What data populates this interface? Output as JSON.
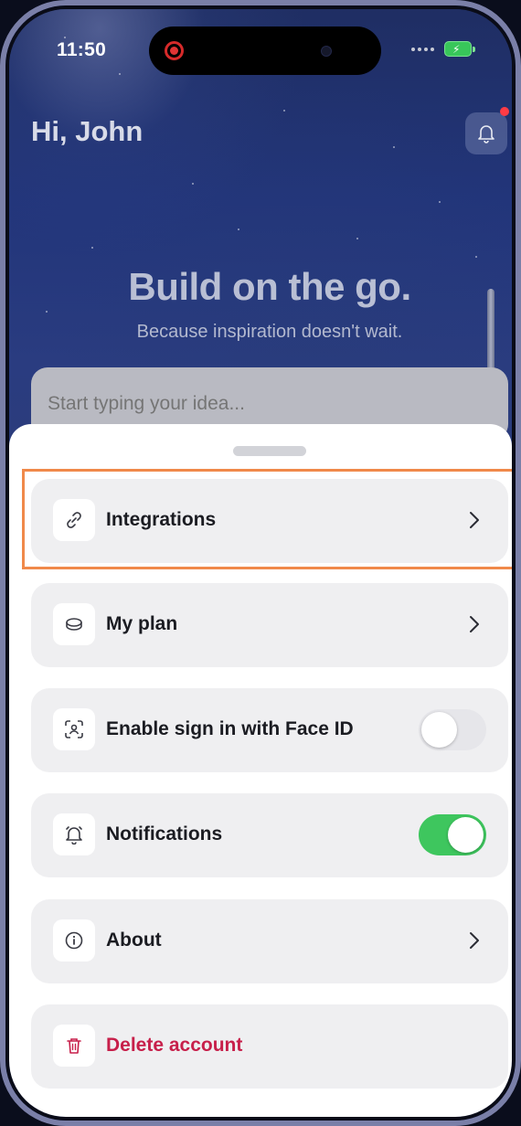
{
  "status_bar": {
    "time": "11:50",
    "battery_state": "charging",
    "battery_color": "#38c65a"
  },
  "header": {
    "greeting": "Hi, John",
    "notification_icon": "bell-icon",
    "has_unread_badge": true
  },
  "hero": {
    "headline": "Build on the go.",
    "subheadline": "Because inspiration doesn't wait.",
    "idea_placeholder": "Start typing your idea..."
  },
  "menu": {
    "items": [
      {
        "label": "Integrations",
        "icon": "link-icon",
        "control": "chevron",
        "highlighted": true
      },
      {
        "label": "My plan",
        "icon": "plan-icon",
        "control": "chevron"
      },
      {
        "label": "Enable sign in with Face ID",
        "icon": "face-id-icon",
        "control": "toggle",
        "toggle_on": false
      },
      {
        "label": "Notifications",
        "icon": "bell-icon",
        "control": "toggle",
        "toggle_on": true
      },
      {
        "label": "About",
        "icon": "info-icon",
        "control": "chevron"
      },
      {
        "label": "Delete account",
        "icon": "trash-icon",
        "control": "none",
        "danger": true
      }
    ]
  },
  "colors": {
    "toggle_on": "#3ec65e",
    "danger": "#c71f4a",
    "highlight_border": "#f0894a"
  }
}
